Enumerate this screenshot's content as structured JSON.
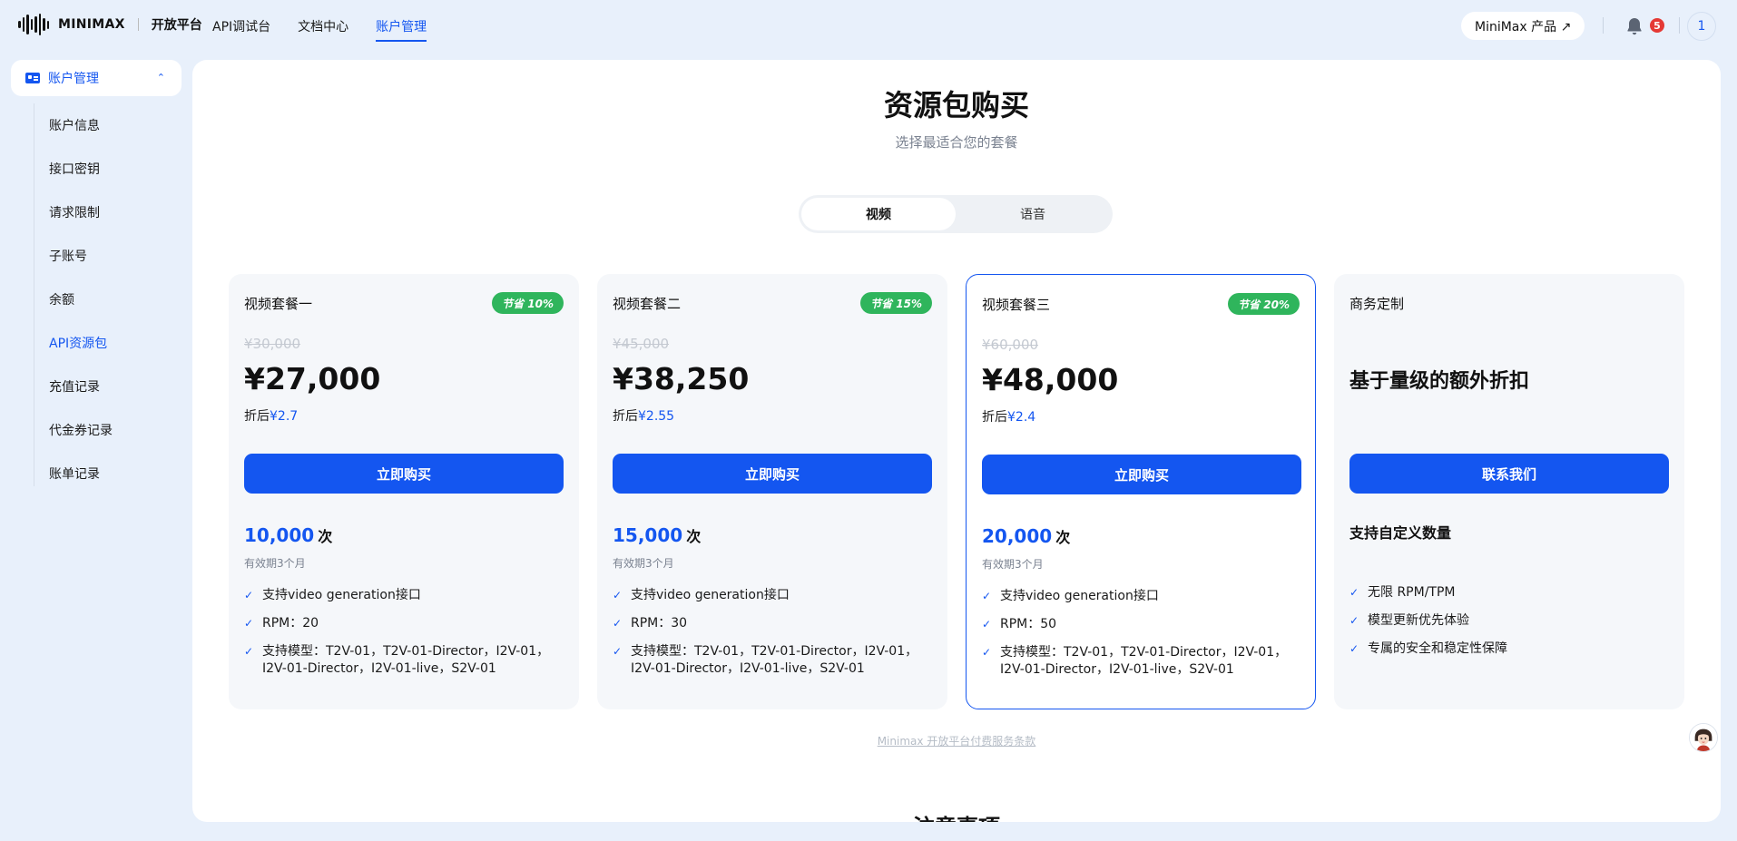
{
  "header": {
    "logo_text": "MINIMAX",
    "platform": "开放平台",
    "nav": [
      "API调试台",
      "文档中心",
      "账户管理"
    ],
    "active_nav": "账户管理",
    "product_label": "MiniMax 产品 ↗",
    "notification_count": "5",
    "avatar_text": "1"
  },
  "sidebar": {
    "section_label": "账户管理",
    "items": [
      {
        "label": "账户信息"
      },
      {
        "label": "接口密钥"
      },
      {
        "label": "请求限制"
      },
      {
        "label": "子账号"
      },
      {
        "label": "余额"
      },
      {
        "label": "API资源包"
      },
      {
        "label": "充值记录"
      },
      {
        "label": "代金券记录"
      },
      {
        "label": "账单记录"
      }
    ],
    "active_item": "API资源包"
  },
  "main": {
    "title": "资源包购买",
    "subtitle": "选择最适合您的套餐",
    "tabs": [
      "视频",
      "语音"
    ],
    "active_tab": "视频",
    "cards": [
      {
        "name": "视频套餐一",
        "badge": "节省 10%",
        "original_price": "¥30,000",
        "price": "¥27,000",
        "unit_prefix": "折后",
        "unit_price": "¥2.7",
        "button": "立即购买",
        "count": "10,000",
        "count_unit": "次",
        "validity": "有效期3个月",
        "features": [
          "支持video generation接口",
          "RPM：20",
          "支持模型：T2V-01，T2V-01-Director，I2V-01，I2V-01-Director，I2V-01-live，S2V-01"
        ]
      },
      {
        "name": "视频套餐二",
        "badge": "节省 15%",
        "original_price": "¥45,000",
        "price": "¥38,250",
        "unit_prefix": "折后",
        "unit_price": "¥2.55",
        "button": "立即购买",
        "count": "15,000",
        "count_unit": "次",
        "validity": "有效期3个月",
        "features": [
          "支持video generation接口",
          "RPM：30",
          "支持模型：T2V-01，T2V-01-Director，I2V-01，I2V-01-Director，I2V-01-live，S2V-01"
        ]
      },
      {
        "name": "视频套餐三",
        "badge": "节省 20%",
        "original_price": "¥60,000",
        "price": "¥48,000",
        "unit_prefix": "折后",
        "unit_price": "¥2.4",
        "button": "立即购买",
        "count": "20,000",
        "count_unit": "次",
        "validity": "有效期3个月",
        "features": [
          "支持video generation接口",
          "RPM：50",
          "支持模型：T2V-01，T2V-01-Director，I2V-01，I2V-01-Director，I2V-01-live，S2V-01"
        ]
      },
      {
        "name": "商务定制",
        "headline": "基于量级的额外折扣",
        "button": "联系我们",
        "custom_title": "支持自定义数量",
        "features": [
          "无限 RPM/TPM",
          "模型更新优先体验",
          "专属的安全和稳定性保障"
        ]
      }
    ],
    "terms_link": "Minimax 开放平台付费服务条款",
    "notice_title": "注意事项"
  },
  "colors": {
    "accent": "#1456f0",
    "badge_green": "#2fb55c",
    "page_bg": "#e8f0fb"
  },
  "icons": [
    "logo-waveform-icon",
    "card-icon",
    "chevron-up-icon",
    "bell-icon",
    "check-icon",
    "assistant-avatar-icon"
  ]
}
